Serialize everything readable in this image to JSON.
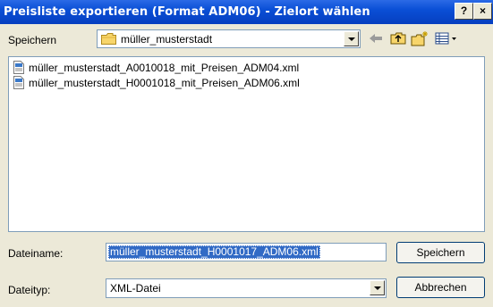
{
  "window": {
    "title": "Preisliste exportieren (Format ADM06) - Zielort wählen",
    "help_label": "?",
    "close_label": "×"
  },
  "toolbar": {
    "savein_label": "Speichern",
    "location": "müller_musterstadt",
    "icons": [
      "back-arrow-icon",
      "up-folder-icon",
      "new-folder-icon",
      "view-menu-icon"
    ]
  },
  "files": [
    {
      "name": "müller_musterstadt_A0010018_mit_Preisen_ADM04.xml",
      "icon": "xml-file-icon"
    },
    {
      "name": "müller_musterstadt_H0001018_mit_Preisen_ADM06.xml",
      "icon": "xml-file-icon"
    }
  ],
  "form": {
    "filename_label": "Dateiname:",
    "filename_value": "müller_musterstadt_H0001017_ADM06.xml",
    "filetype_label": "Dateityp:",
    "filetype_value": "XML-Datei"
  },
  "buttons": {
    "save": "Speichern",
    "cancel": "Abbrechen"
  },
  "colors": {
    "titlebar": "#0a4fd6",
    "dialog_bg": "#ece9d8",
    "selection": "#316ac5",
    "input_border": "#7f9db9"
  }
}
